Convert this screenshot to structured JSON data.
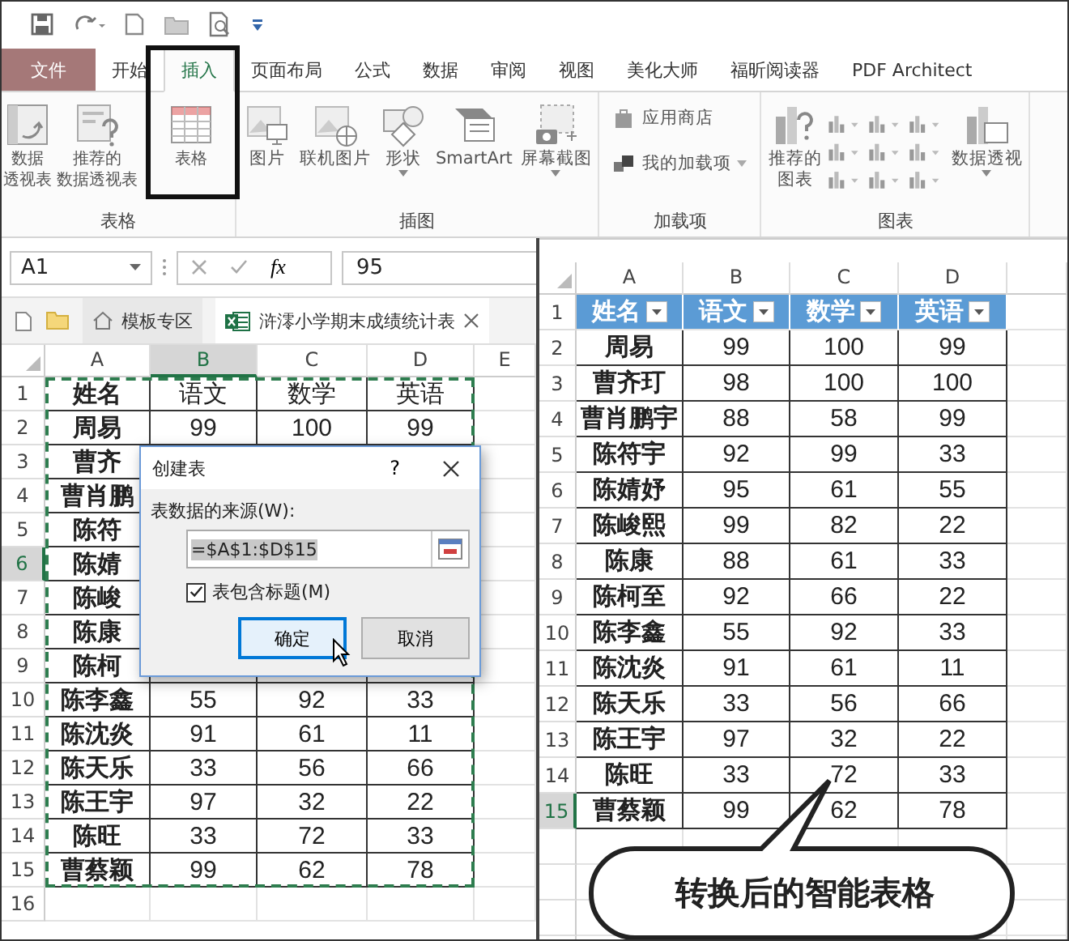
{
  "ribbon": {
    "tabs": [
      {
        "label": "文件",
        "kind": "file",
        "selected": false
      },
      {
        "label": "开始",
        "kind": "tab",
        "selected": false
      },
      {
        "label": "插入",
        "kind": "tab",
        "selected": true
      },
      {
        "label": "页面布局",
        "kind": "tab",
        "selected": false
      },
      {
        "label": "公式",
        "kind": "tab",
        "selected": false
      },
      {
        "label": "数据",
        "kind": "tab",
        "selected": false
      },
      {
        "label": "审阅",
        "kind": "tab",
        "selected": false
      },
      {
        "label": "视图",
        "kind": "tab",
        "selected": false
      },
      {
        "label": "美化大师",
        "kind": "tab",
        "selected": false
      },
      {
        "label": "福昕阅读器",
        "kind": "tab",
        "selected": false
      },
      {
        "label": "PDF Architect",
        "kind": "tab",
        "selected": false
      }
    ],
    "groups": [
      {
        "label": "表格",
        "buttons": [
          {
            "kind": "large",
            "lines": [
              "数据",
              "透视表"
            ]
          },
          {
            "kind": "large",
            "lines": [
              "推荐的",
              "数据透视表"
            ]
          },
          {
            "kind": "large",
            "lines": [
              "表格"
            ]
          }
        ]
      },
      {
        "label": "插图",
        "buttons": [
          {
            "kind": "large",
            "lines": [
              "图片"
            ]
          },
          {
            "kind": "large",
            "lines": [
              "联机图片"
            ]
          },
          {
            "kind": "large",
            "lines": [
              "形状"
            ],
            "dropdown": true
          },
          {
            "kind": "large",
            "lines": [
              "SmartArt"
            ]
          },
          {
            "kind": "large",
            "lines": [
              "屏幕截图"
            ],
            "dropdown": true
          }
        ]
      },
      {
        "label": "加载项",
        "buttons": [
          {
            "kind": "small",
            "lines": [
              "应用商店"
            ]
          },
          {
            "kind": "small",
            "lines": [
              "我的加载项"
            ],
            "dropdown": true
          }
        ]
      },
      {
        "label": "图表",
        "buttons": [
          {
            "kind": "large",
            "lines": [
              "推荐的",
              "图表"
            ]
          },
          {
            "kind": "gallery"
          },
          {
            "kind": "large",
            "lines": [
              "数据透视"
            ],
            "dropdown": true
          }
        ]
      }
    ]
  },
  "formula_bar": {
    "name_box": "A1",
    "function_label": "fx",
    "formula": "95"
  },
  "sheet_tabs": [
    {
      "label": "模板专区",
      "kind": "home",
      "selected": false
    },
    {
      "label": "浒澪小学期末成绩统计表",
      "kind": "workbook",
      "selected": true
    }
  ],
  "left_sheet": {
    "columns": [
      {
        "label": "A",
        "selected": false
      },
      {
        "label": "B",
        "selected": true
      },
      {
        "label": "C",
        "selected": false
      },
      {
        "label": "D",
        "selected": false
      },
      {
        "label": "E",
        "selected": false
      }
    ],
    "rows": [
      {
        "num": "1",
        "selected": false,
        "cells": [
          "姓名",
          "语文",
          "数学",
          "英语"
        ]
      },
      {
        "num": "2",
        "selected": false,
        "cells": [
          "周易",
          "99",
          "100",
          "99"
        ]
      },
      {
        "num": "3",
        "selected": false,
        "cells": [
          "曹齐"
        ]
      },
      {
        "num": "4",
        "selected": false,
        "cells": [
          "曹肖鹏"
        ]
      },
      {
        "num": "5",
        "selected": false,
        "cells": [
          "陈符"
        ]
      },
      {
        "num": "6",
        "selected": true,
        "cells": [
          "陈婧"
        ]
      },
      {
        "num": "7",
        "selected": false,
        "cells": [
          "陈峻"
        ]
      },
      {
        "num": "8",
        "selected": false,
        "cells": [
          "陈康"
        ]
      },
      {
        "num": "9",
        "selected": false,
        "cells": [
          "陈柯"
        ]
      },
      {
        "num": "10",
        "selected": false,
        "cells": [
          "陈李鑫",
          "55",
          "92",
          "33"
        ]
      },
      {
        "num": "11",
        "selected": false,
        "cells": [
          "陈沈炎",
          "91",
          "61",
          "11"
        ]
      },
      {
        "num": "12",
        "selected": false,
        "cells": [
          "陈天乐",
          "33",
          "56",
          "66"
        ]
      },
      {
        "num": "13",
        "selected": false,
        "cells": [
          "陈王宇",
          "97",
          "32",
          "22"
        ]
      },
      {
        "num": "14",
        "selected": false,
        "cells": [
          "陈旺",
          "33",
          "72",
          "33"
        ]
      },
      {
        "num": "15",
        "selected": false,
        "cells": [
          "曹蔡颖",
          "99",
          "62",
          "78"
        ]
      },
      {
        "num": "16",
        "selected": false,
        "cells": []
      }
    ]
  },
  "dialog": {
    "title": "创建表",
    "help": "?",
    "source_label": "表数据的来源(W):",
    "source_value": "=$A$1:$D$15",
    "has_headers": {
      "label": "表包含标题(M)",
      "checked": true
    },
    "buttons": [
      {
        "label": "确定",
        "default": true
      },
      {
        "label": "取消",
        "default": false
      }
    ]
  },
  "right_sheet": {
    "columns": [
      {
        "label": "A",
        "selected": false
      },
      {
        "label": "B",
        "selected": false
      },
      {
        "label": "C",
        "selected": false
      },
      {
        "label": "D",
        "selected": false
      }
    ],
    "rows": [
      {
        "num": "1",
        "kind": "header",
        "selected": false,
        "cells": [
          "姓名",
          "语文",
          "数学",
          "英语"
        ]
      },
      {
        "num": "2",
        "kind": "data",
        "selected": false,
        "cells": [
          "周易",
          "99",
          "100",
          "99"
        ]
      },
      {
        "num": "3",
        "kind": "data",
        "selected": false,
        "cells": [
          "曹齐玎",
          "98",
          "100",
          "100"
        ]
      },
      {
        "num": "4",
        "kind": "data",
        "selected": false,
        "cells": [
          "曹肖鹏宇",
          "88",
          "58",
          "99"
        ]
      },
      {
        "num": "5",
        "kind": "data",
        "selected": false,
        "cells": [
          "陈符宇",
          "92",
          "99",
          "33"
        ]
      },
      {
        "num": "6",
        "kind": "data",
        "selected": false,
        "cells": [
          "陈婧妤",
          "95",
          "61",
          "55"
        ]
      },
      {
        "num": "7",
        "kind": "data",
        "selected": false,
        "cells": [
          "陈峻熙",
          "99",
          "82",
          "22"
        ]
      },
      {
        "num": "8",
        "kind": "data",
        "selected": false,
        "cells": [
          "陈康",
          "88",
          "61",
          "33"
        ]
      },
      {
        "num": "9",
        "kind": "data",
        "selected": false,
        "cells": [
          "陈柯至",
          "92",
          "66",
          "22"
        ]
      },
      {
        "num": "10",
        "kind": "data",
        "selected": false,
        "cells": [
          "陈李鑫",
          "55",
          "92",
          "33"
        ]
      },
      {
        "num": "11",
        "kind": "data",
        "selected": false,
        "cells": [
          "陈沈炎",
          "91",
          "61",
          "11"
        ]
      },
      {
        "num": "12",
        "kind": "data",
        "selected": false,
        "cells": [
          "陈天乐",
          "33",
          "56",
          "66"
        ]
      },
      {
        "num": "13",
        "kind": "data",
        "selected": false,
        "cells": [
          "陈王宇",
          "97",
          "32",
          "22"
        ]
      },
      {
        "num": "14",
        "kind": "data",
        "selected": false,
        "cells": [
          "陈旺",
          "33",
          "72",
          "33"
        ]
      },
      {
        "num": "15",
        "kind": "data",
        "selected": true,
        "cells": [
          "曹蔡颖",
          "99",
          "62",
          "78"
        ]
      }
    ]
  },
  "callout": {
    "text": "转换后的智能表格"
  }
}
